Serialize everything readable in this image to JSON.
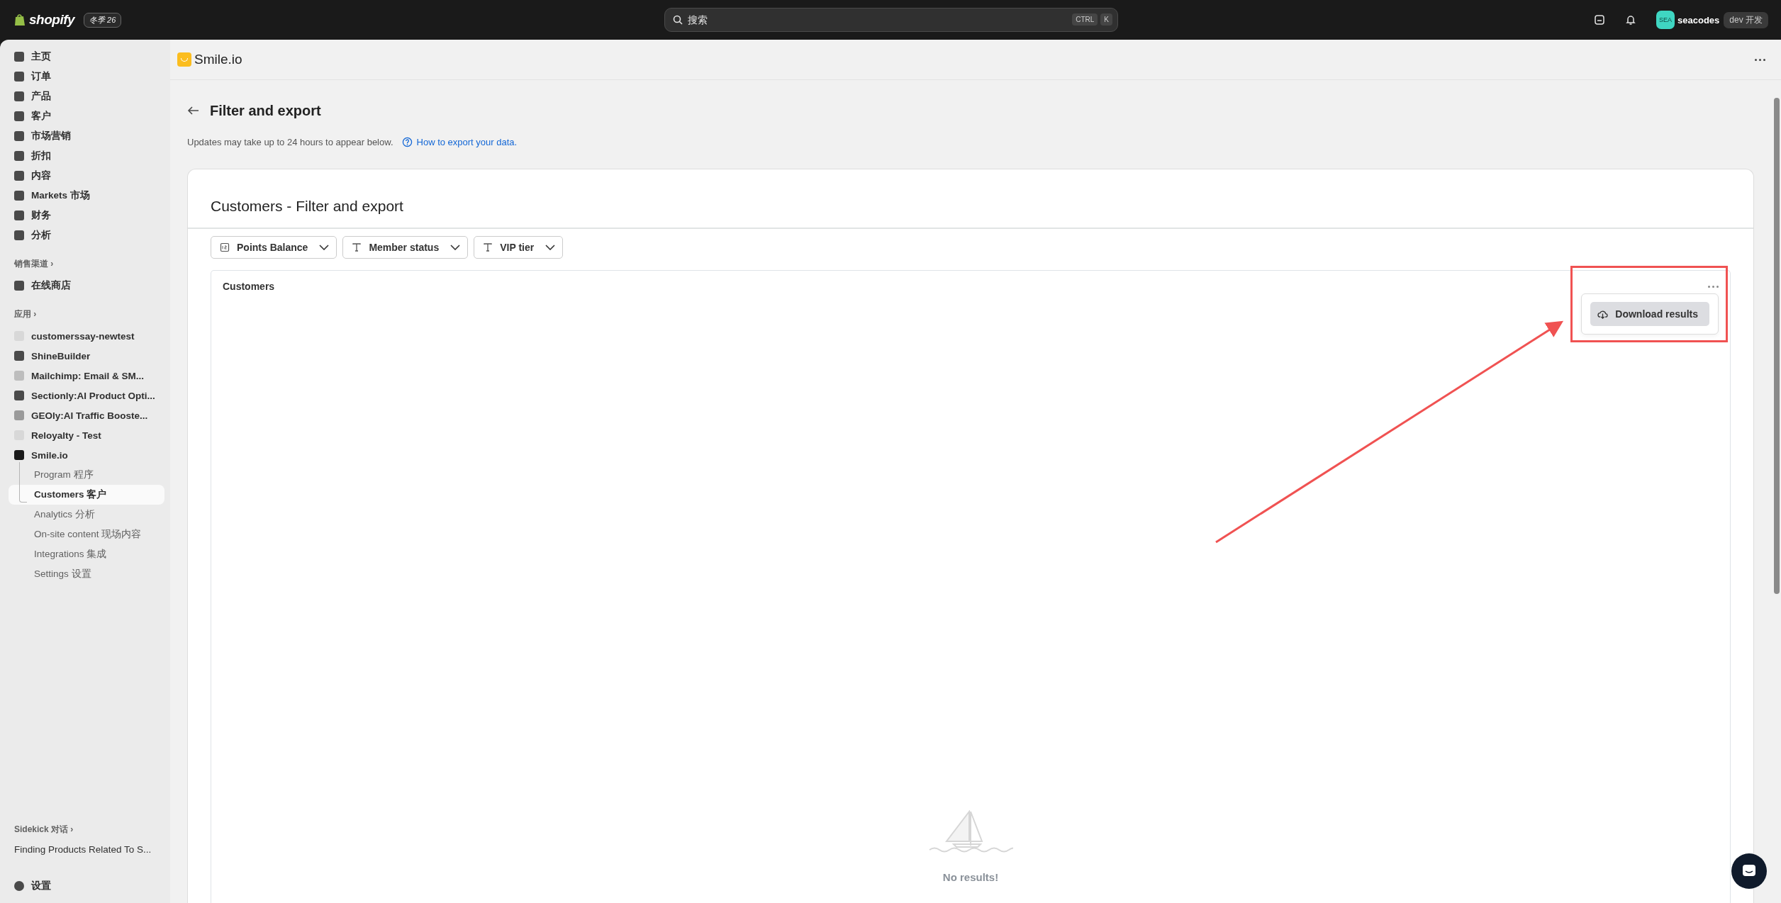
{
  "topbar": {
    "logo": "shopify",
    "edition_badge": "冬季 26",
    "search": {
      "placeholder": "搜索",
      "keys": [
        "CTRL",
        "K"
      ]
    },
    "avatar": "SEA",
    "store": "seacodes",
    "store_badge": "dev 开发"
  },
  "sidebar": {
    "nav": [
      {
        "label": "主页",
        "selected": false
      },
      {
        "label": "订单",
        "selected": false
      },
      {
        "label": "产品",
        "selected": false
      },
      {
        "label": "客户",
        "selected": false
      },
      {
        "label": "市场营销",
        "selected": false
      },
      {
        "label": "折扣",
        "selected": false
      },
      {
        "label": "内容",
        "selected": false
      },
      {
        "label": "Markets 市场",
        "selected": false
      },
      {
        "label": "财务",
        "selected": false
      },
      {
        "label": "分析",
        "selected": false
      }
    ],
    "channels_heading": "销售渠道 ›",
    "channels": [
      {
        "label": "在线商店",
        "selected": false
      }
    ],
    "apps_heading": "应用 ›",
    "apps": [
      {
        "label": "customerssay-newtest",
        "selected": false
      },
      {
        "label": "ShineBuilder",
        "selected": false
      },
      {
        "label": "Mailchimp: Email & SM...",
        "selected": false
      },
      {
        "label": "Sectionly:AI Product Opti...",
        "selected": false
      },
      {
        "label": "GEOly:AI Traffic Booste...",
        "selected": false
      },
      {
        "label": "Reloyalty - Test",
        "selected": false
      },
      {
        "label": "Smile.io",
        "selected": false,
        "children": [
          {
            "label": "Program 程序",
            "selected": false
          },
          {
            "label": "Customers 客户",
            "selected": true
          },
          {
            "label": "Analytics 分析",
            "selected": false
          },
          {
            "label": "On-site content 现场内容",
            "selected": false
          },
          {
            "label": "Integrations 集成",
            "selected": false
          },
          {
            "label": "Settings 设置",
            "selected": false
          }
        ]
      }
    ],
    "sidekick_heading": "Sidekick 对话 ›",
    "sidekick_item": "Finding Products Related To S...",
    "settings": "设置"
  },
  "app_header": {
    "title": "Smile.io"
  },
  "page": {
    "title": "Filter and export",
    "note": "Updates may take up to 24 hours to appear below.",
    "help_link": "How to export your data.",
    "card": {
      "title": "Customers - Filter and export",
      "filters": [
        {
          "label": "Points Balance",
          "kind": "number"
        },
        {
          "label": "Member status",
          "kind": "text"
        },
        {
          "label": "VIP tier",
          "kind": "text"
        }
      ],
      "panel": {
        "title": "Customers",
        "menu_open": true,
        "menu_items": [
          "Download results"
        ],
        "empty_text": "No results!"
      }
    }
  }
}
